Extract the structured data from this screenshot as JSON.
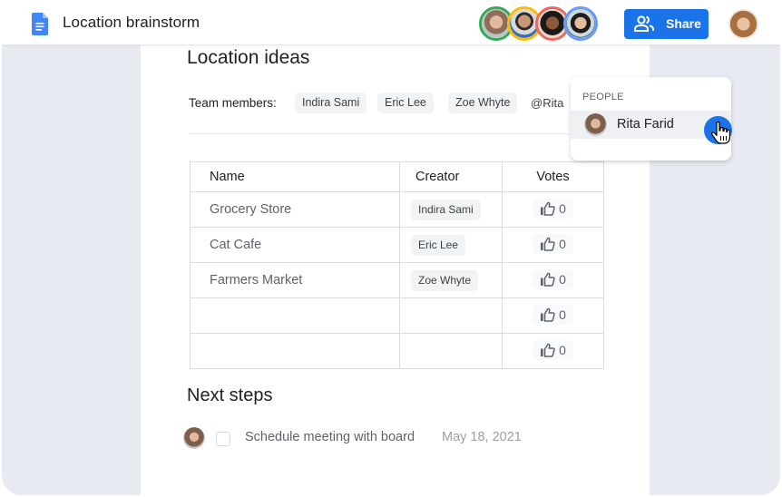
{
  "app": {
    "doc_title": "Location brainstorm",
    "doc_icon": "google-docs-icon",
    "share_label": "Share",
    "share_icon": "people-icon",
    "colors": {
      "accent": "#1a73e8",
      "doc_blue": "#4285f4"
    }
  },
  "collaborators": [
    {
      "name": "collaborator-1",
      "ring_color": "#34a853"
    },
    {
      "name": "collaborator-2",
      "ring_color": "#fbbc04"
    },
    {
      "name": "collaborator-3",
      "ring_color": "#ee675c"
    },
    {
      "name": "collaborator-4",
      "ring_color": "#669df6"
    }
  ],
  "doc": {
    "heading": "Location ideas",
    "team_label": "Team members:",
    "team_members": [
      "Indira Sami",
      "Eric Lee",
      "Zoe Whyte"
    ],
    "mention_text": "@Rita",
    "table": {
      "headers": [
        "Name",
        "Creator",
        "Votes"
      ],
      "rows": [
        {
          "name": "Grocery Store",
          "creator": "Indira Sami",
          "votes": "0"
        },
        {
          "name": "Cat Cafe",
          "creator": "Eric Lee",
          "votes": "0"
        },
        {
          "name": "Farmers Market",
          "creator": "Zoe Whyte",
          "votes": "0"
        },
        {
          "name": "",
          "creator": "",
          "votes": "0"
        },
        {
          "name": "",
          "creator": "",
          "votes": "0"
        }
      ]
    },
    "next_steps_heading": "Next steps",
    "task": {
      "text": "Schedule meeting with board",
      "date": "May 18, 2021",
      "checked": false
    }
  },
  "mention_popup": {
    "section_label": "PEOPLE",
    "suggestions": [
      {
        "name": "Rita Farid"
      }
    ]
  }
}
